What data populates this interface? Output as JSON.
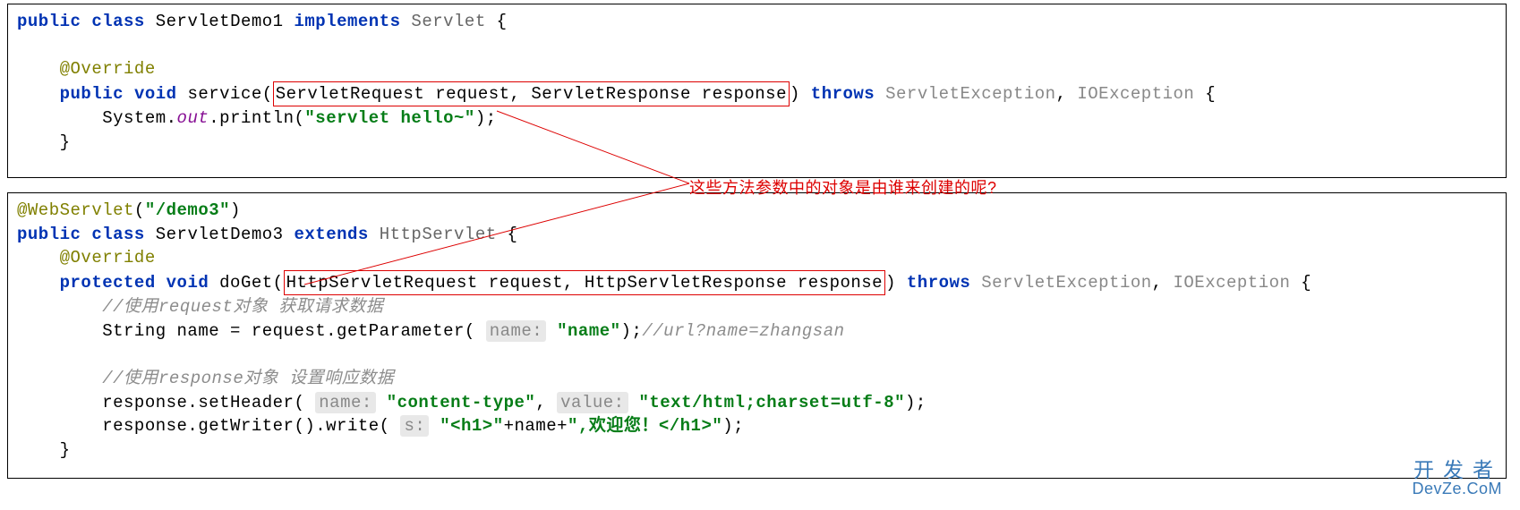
{
  "box1": {
    "line1": {
      "kw_public": "public",
      "kw_class": "class",
      "name": "ServletDemo1",
      "kw_implements": "implements",
      "iface": "Servlet",
      "brace": " {"
    },
    "line2": {
      "ann": "@Override"
    },
    "line3": {
      "kw_public": "public",
      "kw_void": "void",
      "method": "service",
      "paren_open": "(",
      "params_boxed": "ServletRequest request, ServletResponse response",
      "paren_close": ")",
      "kw_throws": "throws",
      "ex1": "ServletException",
      "comma": ",",
      "ex2": "IOException",
      "brace": " {"
    },
    "line4": {
      "prefix": "System.",
      "field": "out",
      "call": ".println(",
      "str": "\"servlet hello~\"",
      "end": ");"
    },
    "line5": {
      "brace": "}"
    }
  },
  "box2": {
    "line1": {
      "ann": "@WebServlet",
      "paren_open": "(",
      "str": "\"/demo3\"",
      "paren_close": ")"
    },
    "line2": {
      "kw_public": "public",
      "kw_class": "class",
      "name": "ServletDemo3",
      "kw_extends": "extends",
      "superclass": "HttpServlet",
      "brace": " {"
    },
    "line3": {
      "ann": "@Override"
    },
    "line4": {
      "kw_protected": "protected",
      "kw_void": "void",
      "method": "doGet",
      "paren_open": "(",
      "params_boxed": "HttpServletRequest request, HttpServletResponse response",
      "paren_close": ")",
      "kw_throws": "throws",
      "ex1": "ServletException",
      "comma": ",",
      "ex2": "IOException",
      "brace": " {"
    },
    "line5": {
      "comment": "//使用request对象 获取请求数据"
    },
    "line6": {
      "pre": "String name = request.getParameter(",
      "hint": "name:",
      "str": "\"name\"",
      "end": ");",
      "comment": "//url?name=zhangsan"
    },
    "line7": {
      "comment": "//使用response对象 设置响应数据"
    },
    "line8": {
      "pre": "response.setHeader(",
      "hint1": "name:",
      "str1": "\"content-type\"",
      "comma": ",",
      "hint2": "value:",
      "str2": "\"text/html;charset=utf-8\"",
      "end": ");"
    },
    "line9": {
      "pre": "response.getWriter().write(",
      "hint": "s:",
      "str1": "\"<h1>\"",
      "plus1": "+name+",
      "str2": "\",欢迎您！</h1>\"",
      "end": ");"
    },
    "line10": {
      "brace": "}"
    }
  },
  "annotation": "这些方法参数中的对象是由谁来创建的呢?",
  "watermark": {
    "cn": "开发者",
    "en": "DevZe.CoM"
  }
}
